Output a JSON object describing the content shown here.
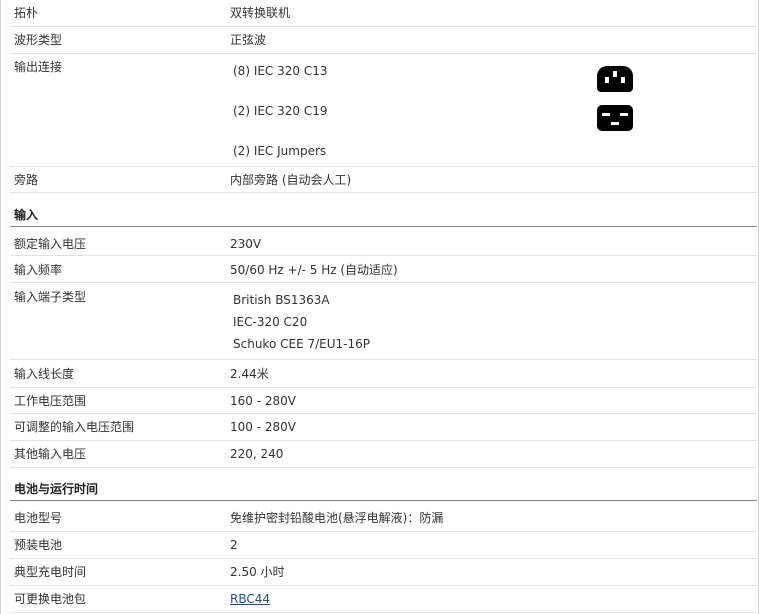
{
  "general": [
    {
      "label": "拓朴",
      "value": "双转换联机"
    },
    {
      "label": "波形类型",
      "value": "正弦波"
    },
    {
      "label": "输出连接",
      "items": [
        "(8) IEC 320 C13",
        "(2) IEC 320 C19",
        "(2) IEC Jumpers"
      ]
    },
    {
      "label": "旁路",
      "value": "内部旁路 (自动会人工)"
    }
  ],
  "input": {
    "title": "输入",
    "rows": [
      {
        "label": "额定输入电压",
        "value": "230V"
      },
      {
        "label": "输入频率",
        "value": "50/60 Hz +/- 5 Hz (自动适应)"
      },
      {
        "label": "输入端子类型",
        "items": [
          "British BS1363A",
          "IEC-320 C20",
          "Schuko CEE 7/EU1-16P"
        ]
      },
      {
        "label": "输入线长度",
        "value": "2.44米"
      },
      {
        "label": "工作电压范围",
        "value": "160 - 280V"
      },
      {
        "label": "可调整的输入电压范围",
        "value": "100 - 280V"
      },
      {
        "label": "其他输入电压",
        "value": "220, 240"
      }
    ]
  },
  "battery": {
    "title": "电池与运行时间",
    "rows": [
      {
        "label": "电池型号",
        "value": "免维护密封铅酸电池(悬浮电解液)：防漏"
      },
      {
        "label": "预装电池",
        "value": "2"
      },
      {
        "label": "典型充电时间",
        "value": "2.50 小时"
      },
      {
        "label": "可更换电池包",
        "value": "RBC44"
      }
    ]
  },
  "icons": [
    "iec-c13-outlet-icon",
    "iec-c19-outlet-icon"
  ]
}
